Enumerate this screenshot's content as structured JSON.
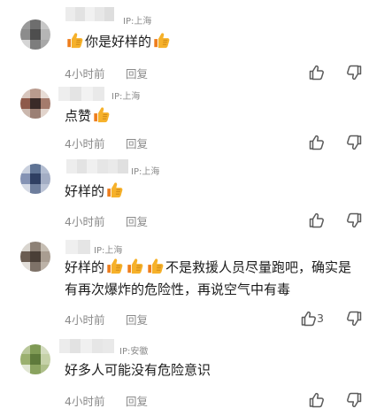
{
  "comments": [
    {
      "ip": "IP:上海",
      "segments": [
        [
          "emoji",
          "thumbs-up"
        ],
        [
          "text",
          "你是好样的"
        ],
        [
          "emoji",
          "thumbs-up"
        ]
      ],
      "time": "4小时前",
      "reply": "回复",
      "likes": ""
    },
    {
      "ip": "IP:上海",
      "segments": [
        [
          "text",
          "点赞"
        ],
        [
          "emoji",
          "thumbs-up"
        ]
      ],
      "time": "4小时前",
      "reply": "回复",
      "likes": ""
    },
    {
      "ip": "IP:上海",
      "segments": [
        [
          "text",
          "好样的"
        ],
        [
          "emoji",
          "thumbs-up"
        ]
      ],
      "time": "4小时前",
      "reply": "回复",
      "likes": ""
    },
    {
      "ip": "IP:上海",
      "segments": [
        [
          "text",
          "好样的"
        ],
        [
          "emoji",
          "thumbs-up"
        ],
        [
          "emoji",
          "thumbs-up"
        ],
        [
          "emoji",
          "thumbs-up"
        ],
        [
          "text",
          "不是救援人员尽量跑吧，确实是"
        ],
        [
          "br",
          ""
        ],
        [
          "text",
          "有再次爆炸的危险性，再说空气中有毒"
        ]
      ],
      "time": "4小时前",
      "reply": "回复",
      "likes": "3"
    },
    {
      "ip": "IP:安徽",
      "segments": [
        [
          "text",
          "好多人可能没有危险意识"
        ]
      ],
      "time": "4小时前",
      "reply": "回复",
      "likes": ""
    }
  ],
  "colors": {
    "secondary_text": "#8a8a8a",
    "emoji_yellow": "#f6b12a",
    "emoji_orange": "#ee7d1c"
  },
  "icons": {
    "like": "thumbs-up-outline-icon",
    "dislike": "thumbs-down-outline-icon",
    "emoji": "thumbs-up-emoji"
  }
}
